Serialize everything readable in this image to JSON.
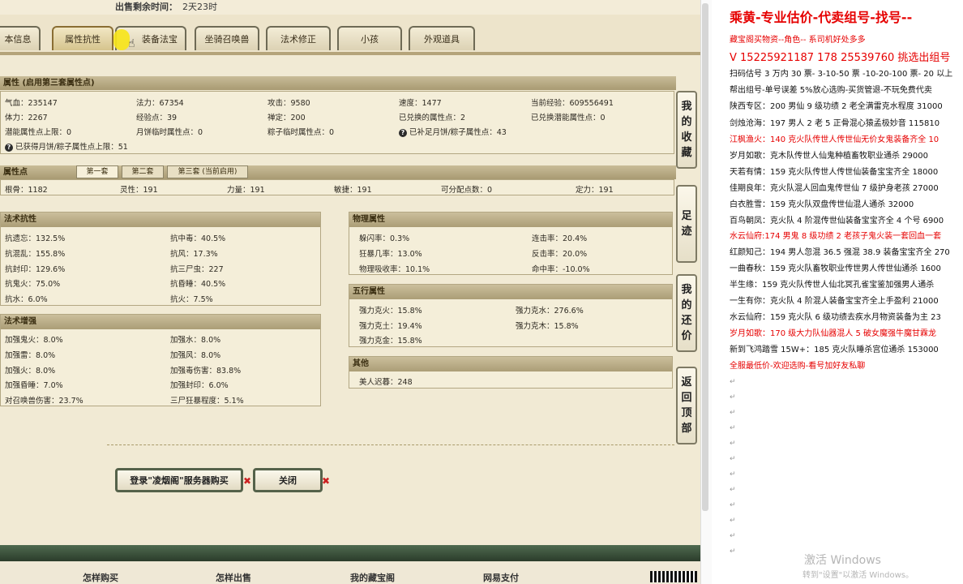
{
  "game": {
    "sale_time_label": "出售剩余时间：",
    "sale_time_value": "2天23时",
    "tabs": [
      "本信息",
      "属性抗性",
      "装备法宝",
      "坐骑召唤兽",
      "法术修正",
      "小孩",
      "外观道具"
    ],
    "attributes": {
      "header": "属性 (启用第三套属性点)",
      "rows": [
        [
          "气血：235147",
          "法力：67354",
          "攻击：9580",
          "速度：1477",
          "当前经验：609556491"
        ],
        [
          "体力：2267",
          "经验点：39",
          "禅定：200",
          "已兑换的属性点：2",
          "已兑换潜能属性点：0"
        ],
        [
          "潜能属性点上限：0",
          "月饼临时属性点：0",
          "粽子临时属性点：0",
          "已补足月饼/粽子属性点：43",
          ""
        ]
      ],
      "note": "已获得月饼/粽子属性点上限：51"
    },
    "points": {
      "header": "属性点",
      "subtabs": [
        "第一套",
        "第二套",
        "第三套 (当前启用)"
      ],
      "values": [
        "根骨：1182",
        "灵性：191",
        "力量：191",
        "敏捷：191",
        "可分配点数：0",
        "定力：191"
      ]
    },
    "resist": {
      "header": "法术抗性",
      "left": [
        "抗遗忘：132.5%",
        "抗混乱：155.8%",
        "抗封印：129.6%",
        "抗鬼火：75.0%",
        "抗水：6.0%"
      ],
      "right": [
        "抗中毒：40.5%",
        "抗风：17.3%",
        "抗三尸虫：227",
        "抗昏睡：40.5%",
        "抗火：7.5%"
      ]
    },
    "boost": {
      "header": "法术增强",
      "left": [
        "加强鬼火：8.0%",
        "加强雷：8.0%",
        "加强火：8.0%",
        "加强昏睡：7.0%",
        "对召唤兽伤害：23.7%"
      ],
      "right": [
        "加强水：8.0%",
        "加强风：8.0%",
        "加强毒伤害：83.8%",
        "加强封印：6.0%",
        "三尸狂暴程度：5.1%"
      ]
    },
    "physical": {
      "header": "物理属性",
      "left": [
        "躲闪率：0.3%",
        "狂暴几率：13.0%",
        "物理吸收率：10.1%"
      ],
      "right": [
        "连击率：20.4%",
        "反击率：20.0%",
        "命中率：-10.0%"
      ]
    },
    "wuxing": {
      "header": "五行属性",
      "left": [
        "强力克火：15.8%",
        "强力克土：19.4%",
        "强力克金：15.8%"
      ],
      "right": [
        "强力克水：276.6%",
        "强力克木：15.8%"
      ]
    },
    "other": {
      "header": "其他",
      "value": "美人迟暮：248"
    },
    "side_buttons": [
      [
        "我",
        "的",
        "收",
        "藏"
      ],
      [
        "足",
        "迹"
      ],
      [
        "我",
        "的",
        "还",
        "价"
      ],
      [
        "返",
        "回",
        "顶",
        "部"
      ]
    ],
    "login_button": "登录\"凌烟阁\"服务器购买",
    "close_button": "关闭",
    "footer_links": [
      "怎样购买",
      "怎样出售",
      "我的藏宝阁",
      "网易支付"
    ]
  },
  "doc": {
    "title": "乘黄-专业估价-代卖组号-找号--",
    "lines": [
      {
        "text": "藏宝阁买物资--角色-- 系司机好处多多",
        "red": true
      },
      {
        "text": "V 15225921187  178 25539760  挑选出组号",
        "red": true,
        "big": true
      },
      {
        "text": "扫码估号 3 万内 30 票- 3-10-50 票  -10-20-100 票- 20 以上",
        "red": false
      },
      {
        "text": "帮出组号-单号误差 5%放心选购-买货管退-不玩免费代卖",
        "red": false
      },
      {
        "text": "陕西专区：200 男仙 9 级功绩 2 老全满雷克水程度 31000",
        "red": false
      },
      {
        "text": "剑烛沧海：197 男人 2 老 5 正骨混心猿孟极妙音 115810",
        "red": false
      },
      {
        "text": "江枫渔火：140 克火队传世人传世仙无价女鬼装备齐全 10",
        "red": true
      },
      {
        "text": "岁月如歌：克木队传世人仙鬼种植畜牧职业通杀 29000",
        "red": false
      },
      {
        "text": "天若有情：159 克火队传世人传世仙装备宝宝齐全 18000",
        "red": false
      },
      {
        "text": "佳期良年：克火队混人回血鬼传世仙 7 级护身老孩 27000",
        "red": false
      },
      {
        "text": "白衣胜雪：159 克火队双盘传世仙混人通杀 32000",
        "red": false
      },
      {
        "text": "百鸟朝凤：克火队 4 阶混传世仙装备宝宝齐全 4 个号 6900",
        "red": false
      },
      {
        "text": "水云仙府:174 男鬼 8 级功绩 2 老孩子鬼火装一套回血一套",
        "red": true
      },
      {
        "text": "红颜知己：194 男人忽混 36.5 强混 38.9 装备宝宝齐全 270",
        "red": false
      },
      {
        "text": "一曲春秋：159 克火队畜牧职业传世男人传世仙通杀 1600",
        "red": false
      },
      {
        "text": "半生缘：159 克火队传世人仙北冥孔雀宝鉴加强男人通杀",
        "red": false
      },
      {
        "text": "一生有你：克火队 4 阶混人装备宝宝齐全上手盈利 21000",
        "red": false
      },
      {
        "text": "水云仙府：159 克火队 6 级功绩去疾水月物资装备为主 23",
        "red": false
      },
      {
        "text": "岁月如歌：170 级大力队仙器混人 5 破女魔强牛魔甘霖龙",
        "red": true
      },
      {
        "text": "新到飞鸿踏雪 15W+：185 克火队睡杀宫位通杀 153000",
        "red": false
      },
      {
        "text": "全服最低价-欢迎选购-看号加好友私聊",
        "red": true
      }
    ],
    "watermark_title": "激活 Windows",
    "watermark_sub": "转到\"设置\"以激活 Windows。"
  },
  "colors": {
    "accent_red": "#e60000",
    "bottom_bar": "#3a4f3a",
    "panel_bg": "#f1ead4"
  }
}
